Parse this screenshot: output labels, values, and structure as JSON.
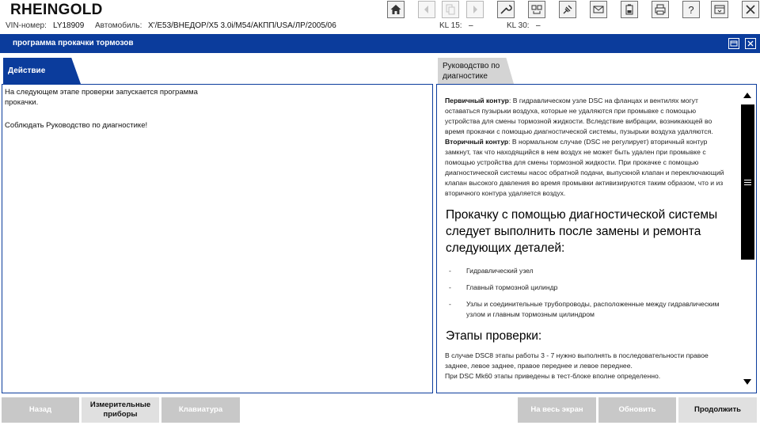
{
  "app": {
    "title": "RHEINGOLD"
  },
  "info": {
    "vin_label": "VIN-номер:",
    "vin_value": "LY18909",
    "car_label": "Автомобиль:",
    "car_value": "X'/E53/ВНЕДОР/X5 3.0i/M54/АКПП/USA/ЛР/2005/06",
    "kl15_label": "KL 15:",
    "kl15_value": "–",
    "kl30_label": "KL 30:",
    "kl30_value": "–"
  },
  "section": {
    "title": "программа прокачки тормозов"
  },
  "tabs": {
    "action": "Действие",
    "guide": "Руководство по диагностике"
  },
  "left_panel": {
    "line1": "На следующем этапе проверки запускается программа",
    "line2": "прокачки.",
    "line3": "Соблюдать Руководство по диагностике!"
  },
  "doc": {
    "p1_bold": "Первичный контур",
    "p1_text": ": В гидравлическом узле DSC на фланцах и вентилях могут оставаться пузырьки воздуха, которые не удаляются при промывке с помощью устройства для смены тормозной жидкости. Вследствие вибрации, возникающей во время прокачки с помощью диагностической системы, пузырьки воздуха удаляются.",
    "p2_bold": "Вторичный контур",
    "p2_text": ": В нормальном случае (DSC не регулирует) вторичный контур замкнут, так что находящийся в нем воздух не может быть удален при промывке с помощью устройства для смены тормозной жидкости. При прокачке с помощью диагностической системы насос обратной подачи, выпускной клапан и переключающий клапан высокого давления во время промывки активизируются таким образом, что и из вторичного контура удаляется воздух.",
    "heading1": "Прокачку с помощью диагностической системы следует выполнить после замены и ремонта следующих деталей:",
    "list": [
      "Гидравлический узел",
      "Главный тормозной цилиндр",
      "Узлы и соединительные трубопроводы, расположенные между гидравлическим узлом и главным тормозным цилиндром"
    ],
    "heading2": "Этапы проверки:",
    "p3": "В случае DSC8 этапы работы 3 - 7 нужно выполнять в последовательности правое заднее, левое заднее, правое переднее и левое переднее.",
    "p4": "При DSC Mk60 этапы приведены в тест-блоке вполне определенно."
  },
  "buttons": {
    "back": "Назад",
    "instruments": "Измерительные приборы",
    "keyboard": "Клавиатура",
    "fullscreen": "На весь экран",
    "refresh": "Обновить",
    "continue": "Продолжить"
  },
  "icons": [
    "home-icon",
    "back-arrow-icon",
    "copy-icon",
    "forward-arrow-icon",
    "wrench-icon",
    "diagnosis-icon",
    "plug-icon",
    "mail-icon",
    "battery-icon",
    "printer-icon",
    "help-icon",
    "minimize-icon",
    "close-icon"
  ]
}
